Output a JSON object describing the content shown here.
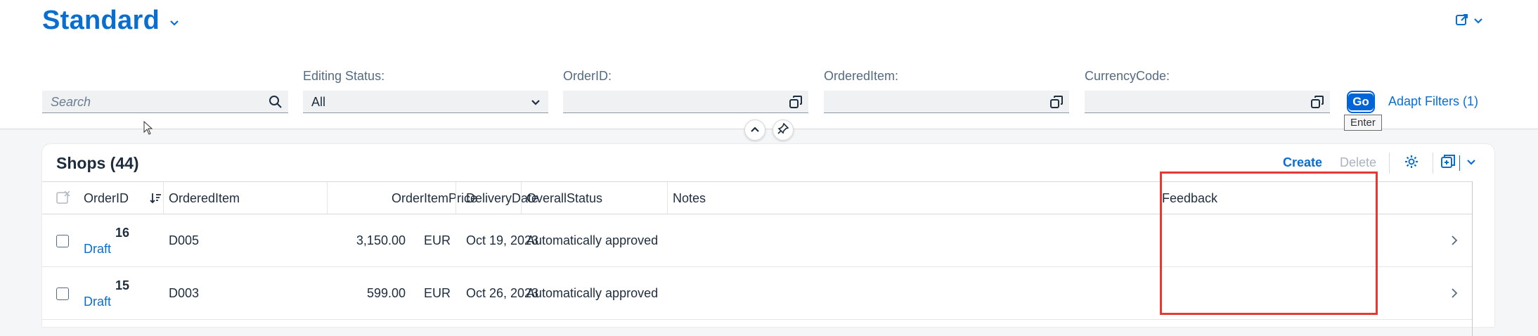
{
  "header": {
    "variant_title": "Standard",
    "filters": {
      "search_placeholder": "Search",
      "editing_status": {
        "label": "Editing Status:",
        "value": "All"
      },
      "order_id": {
        "label": "OrderID:",
        "value": ""
      },
      "ordered_item": {
        "label": "OrderedItem:",
        "value": ""
      },
      "currency_code": {
        "label": "CurrencyCode:",
        "value": ""
      }
    },
    "go_label": "Go",
    "go_tooltip": "Enter",
    "adapt_filters_label": "Adapt Filters (1)"
  },
  "table": {
    "title": "Shops (44)",
    "toolbar": {
      "create_label": "Create",
      "delete_label": "Delete"
    },
    "columns": [
      "OrderID",
      "OrderedItem",
      "OrderItemPrice",
      "DeliveryDate",
      "OverallStatus",
      "Notes",
      "Feedback"
    ],
    "rows": [
      {
        "order_id": "16",
        "draft": "Draft",
        "ordered_item": "D005",
        "price": "3,150.00",
        "currency": "EUR",
        "delivery_date": "Oct 19, 2023",
        "status": "Automatically approved",
        "notes": "",
        "feedback": ""
      },
      {
        "order_id": "15",
        "draft": "Draft",
        "ordered_item": "D003",
        "price": "599.00",
        "currency": "EUR",
        "delivery_date": "Oct 26, 2023",
        "status": "Automatically approved",
        "notes": "",
        "feedback": ""
      }
    ]
  },
  "colors": {
    "accent": "#0a6ed1",
    "highlight": "#e53935"
  }
}
